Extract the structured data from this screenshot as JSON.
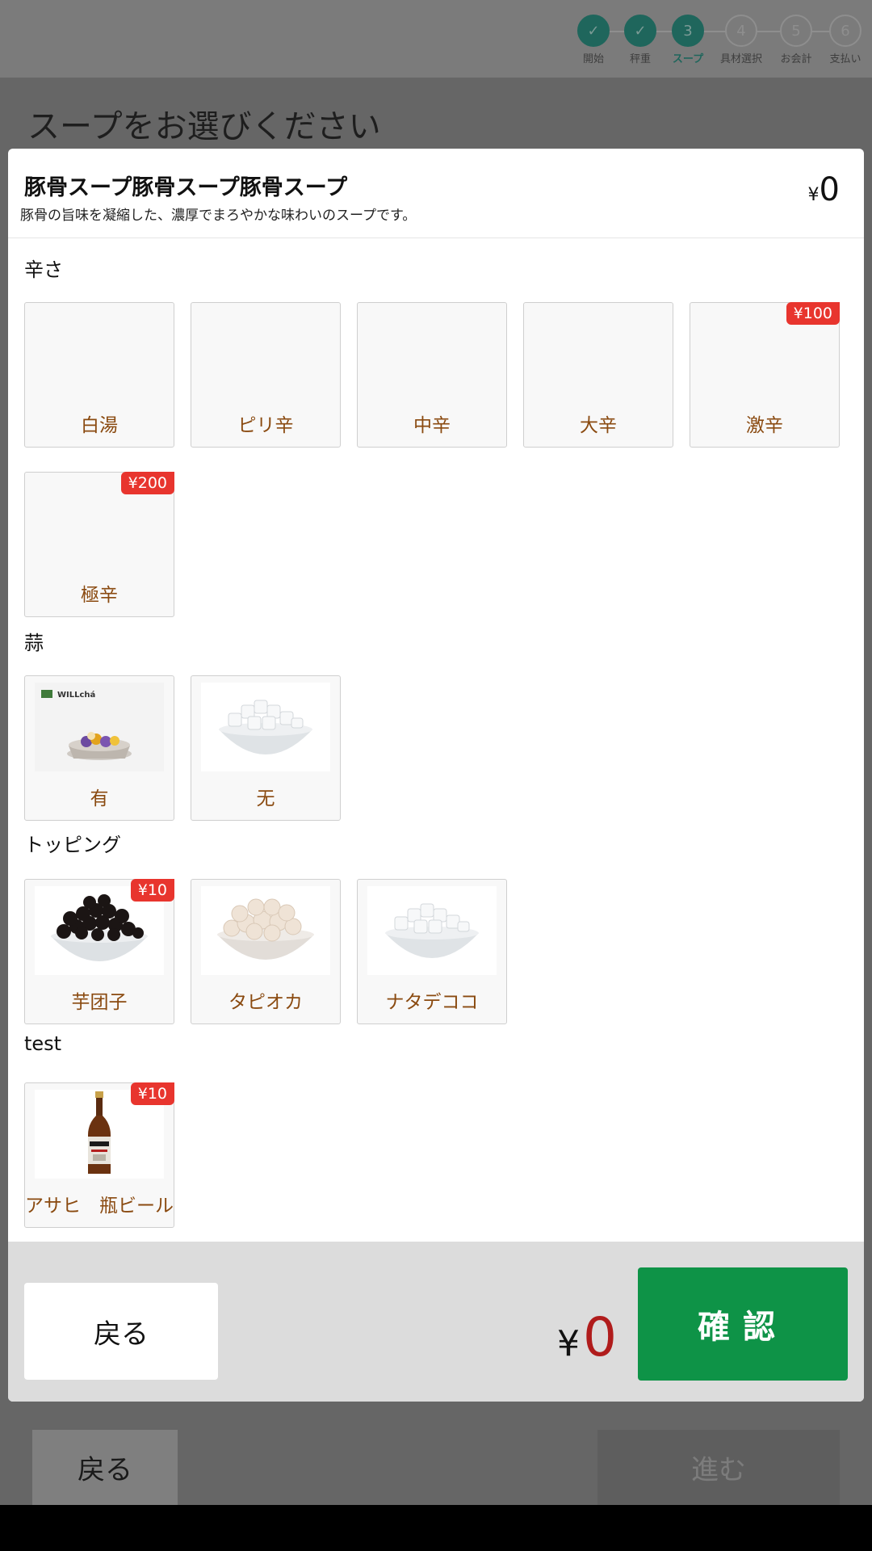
{
  "steps": [
    {
      "label": "開始",
      "number": "1",
      "state": "done"
    },
    {
      "label": "秤重",
      "number": "2",
      "state": "done"
    },
    {
      "label": "スープ",
      "number": "3",
      "state": "active"
    },
    {
      "label": "具材選択",
      "number": "4",
      "state": "pending"
    },
    {
      "label": "お会計",
      "number": "5",
      "state": "pending"
    },
    {
      "label": "支払い",
      "number": "6",
      "state": "pending"
    }
  ],
  "page": {
    "title": "スープをお選びください",
    "back_label": "戻る",
    "next_label": "進む"
  },
  "modal": {
    "title": "豚骨スープ豚骨スープ豚骨スープ",
    "description": "豚骨の旨味を凝縮した、濃厚でまろやかな味わいのスープです。",
    "price_currency": "¥",
    "price_value": "0",
    "groups": [
      {
        "label": "辛さ",
        "options": [
          {
            "name": "白湯",
            "badge": ""
          },
          {
            "name": "ピリ辛",
            "badge": ""
          },
          {
            "name": "中辛",
            "badge": ""
          },
          {
            "name": "大辛",
            "badge": ""
          },
          {
            "name": "激辛",
            "badge": "¥100"
          },
          {
            "name": "極辛",
            "badge": "¥200"
          }
        ]
      },
      {
        "label": "蒜",
        "options": [
          {
            "name": "有",
            "badge": "",
            "image": "willcha-bowl-icon",
            "image_text": "WILLchá"
          },
          {
            "name": "无",
            "badge": "",
            "image": "coconut-jelly-bowl-icon"
          }
        ]
      },
      {
        "label": "トッピング",
        "options": [
          {
            "name": "芋团子",
            "badge": "¥10",
            "image": "black-pearl-bowl-icon"
          },
          {
            "name": "タピオカ",
            "badge": "",
            "image": "tapioca-bowl-icon"
          },
          {
            "name": "ナタデココ",
            "badge": "",
            "image": "coconut-jelly-bowl-icon"
          }
        ]
      },
      {
        "label": "test",
        "options": [
          {
            "name": "アサヒ　瓶ビール",
            "badge": "¥10",
            "image": "beer-bottle-icon"
          }
        ]
      }
    ],
    "footer": {
      "back_label": "戻る",
      "total_currency": "¥",
      "total_value": "0",
      "confirm_label": "確認"
    }
  },
  "colors": {
    "confirm": "#0e9347",
    "badge": "#e8352e",
    "option_text": "#8a4a10",
    "total": "#b01c1c",
    "step_active": "#1f665c"
  }
}
